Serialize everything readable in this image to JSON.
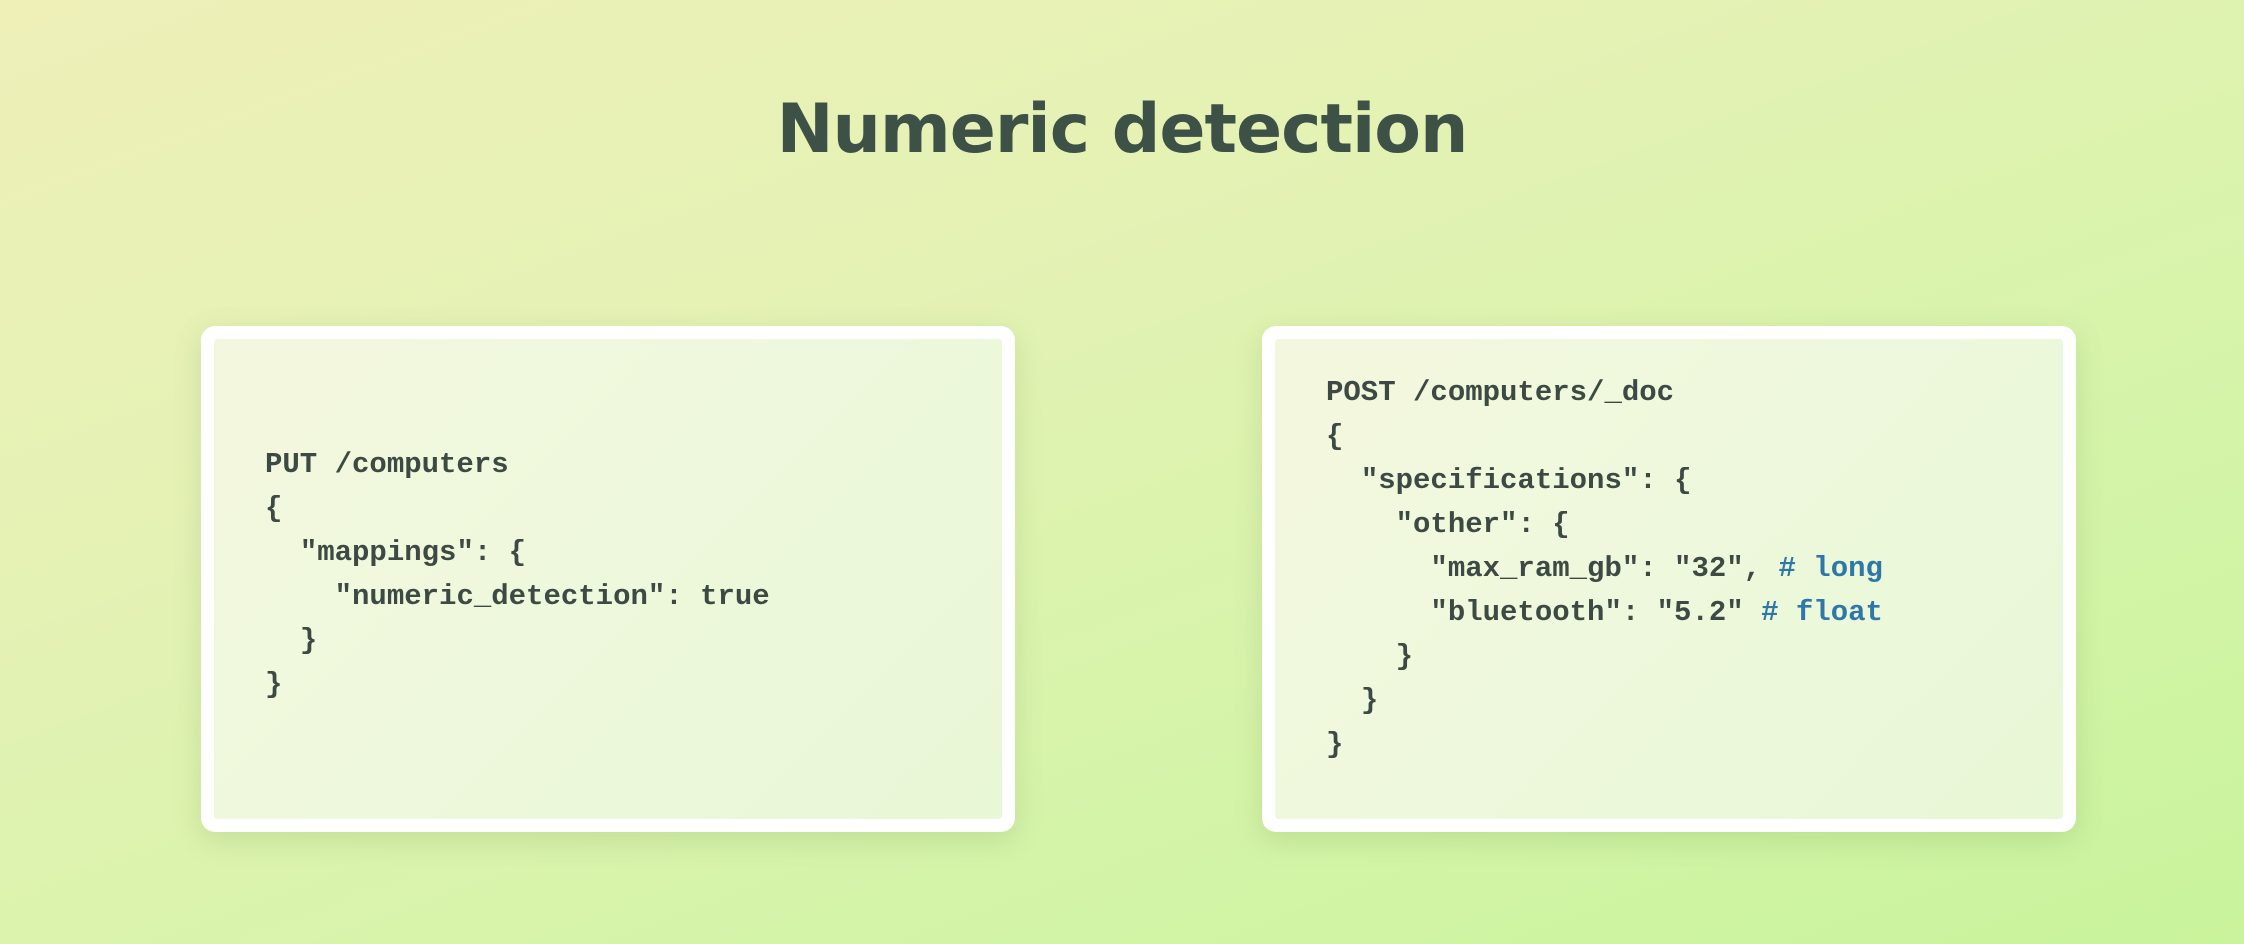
{
  "title": "Numeric detection",
  "left_card": {
    "lines": [
      {
        "indent": 0,
        "text": "PUT /computers"
      },
      {
        "indent": 0,
        "text": "{"
      },
      {
        "indent": 1,
        "text": "\"mappings\": {"
      },
      {
        "indent": 2,
        "text": "\"numeric_detection\": true"
      },
      {
        "indent": 1,
        "text": "}"
      },
      {
        "indent": 0,
        "text": "}"
      }
    ]
  },
  "right_card": {
    "lines": [
      {
        "indent": 0,
        "text": "POST /computers/_doc",
        "comment": ""
      },
      {
        "indent": 0,
        "text": "{",
        "comment": ""
      },
      {
        "indent": 1,
        "text": "\"specifications\": {",
        "comment": ""
      },
      {
        "indent": 2,
        "text": "\"other\": {",
        "comment": ""
      },
      {
        "indent": 3,
        "text": "\"max_ram_gb\": \"32\", ",
        "comment": "# long"
      },
      {
        "indent": 3,
        "text": "\"bluetooth\": \"5.2\" ",
        "comment": "# float"
      },
      {
        "indent": 2,
        "text": "}",
        "comment": ""
      },
      {
        "indent": 1,
        "text": "}",
        "comment": ""
      },
      {
        "indent": 0,
        "text": "}",
        "comment": ""
      }
    ]
  },
  "colors": {
    "title": "#3d5147",
    "code_text": "#3d4a43",
    "comment": "#2e78a8"
  }
}
